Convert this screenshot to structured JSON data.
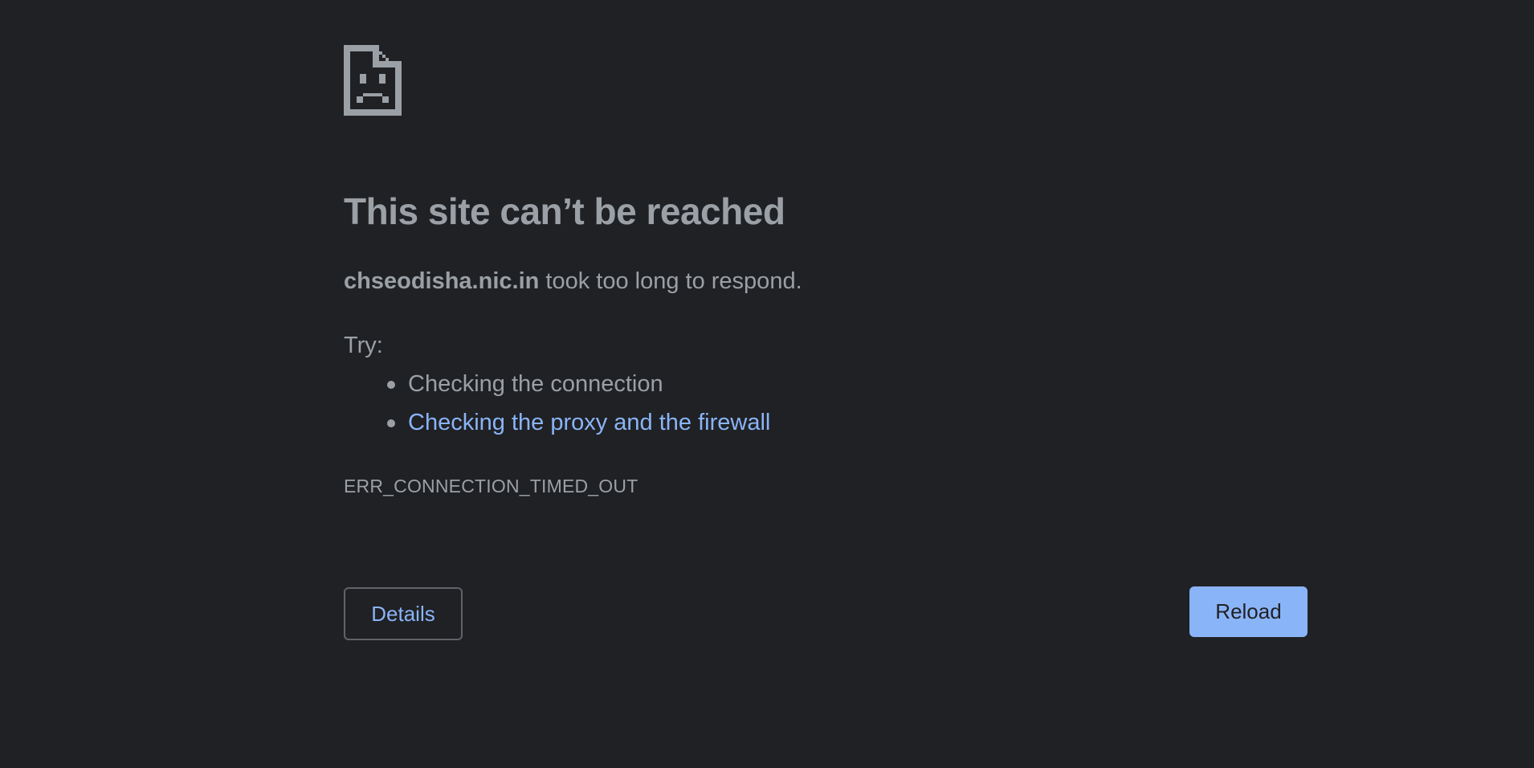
{
  "error_icon": "sad-page-icon",
  "title": "This site can’t be reached",
  "summary": {
    "host": "chseodisha.nic.in",
    "message": " took too long to respond."
  },
  "try_label": "Try:",
  "suggestions": [
    {
      "text": "Checking the connection",
      "is_link": false
    },
    {
      "text": "Checking the proxy and the firewall",
      "is_link": true
    }
  ],
  "error_code": "ERR_CONNECTION_TIMED_OUT",
  "buttons": {
    "details_label": "Details",
    "reload_label": "Reload"
  },
  "colors": {
    "background": "#202124",
    "text": "#9aa0a6",
    "link": "#8ab4f8",
    "primary_button": "#8ab4f8"
  }
}
